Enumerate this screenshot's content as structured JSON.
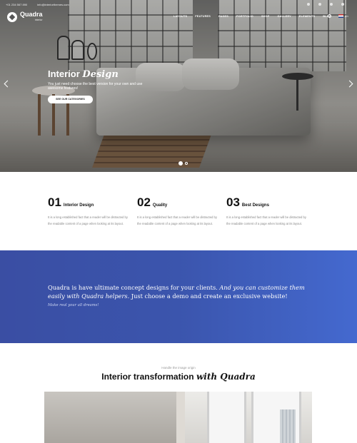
{
  "topbar": {
    "phone": "+01 234 567 890",
    "email": "info@interiorthemes.com",
    "social_icons": [
      "facebook-icon",
      "twitter-icon",
      "instagram-icon",
      "pinterest-icon"
    ]
  },
  "logo": {
    "name": "Quadra",
    "subtitle": "interior"
  },
  "nav": {
    "items": [
      "LAYOUTS",
      "FEATURES",
      "PAGES",
      "PORTFOLIO",
      "SHOP",
      "GALLERY",
      "ELEMENTS",
      "BLOG"
    ],
    "language": "En"
  },
  "hero": {
    "title_plain": "Interior",
    "title_italic": "Design",
    "subtitle": "You just need choose the best version for your own and use awesome features!",
    "button_label": "SEE OUR CATEGORIES"
  },
  "features": [
    {
      "number": "01",
      "title": "Interior Design",
      "text": "It is a long established fact that a reader will be distracted by the readable content of a page when looking at its layout."
    },
    {
      "number": "02",
      "title": "Quality",
      "text": "It is a long established fact that a reader will be distracted by the readable content of a page when looking at its layout."
    },
    {
      "number": "03",
      "title": "Best Designs",
      "text": "It is a long established fact that a reader will be distracted by the readable content of a page when looking at its layout."
    }
  ],
  "band": {
    "text_plain_1": "Quadra is have ultimate concept designs for your clients.",
    "text_italic": "And you can customize them easily with Quadra helpers.",
    "text_plain_2": "Just choose a demo and create an exclusive website!",
    "subline": "Make real your all dreams!"
  },
  "interior": {
    "caption": "Handle the image origin",
    "title_plain": "Interior transformation",
    "title_italic": "with Quadra"
  },
  "colors": {
    "band_start": "#3a4ea3",
    "band_end": "#4469cf"
  }
}
